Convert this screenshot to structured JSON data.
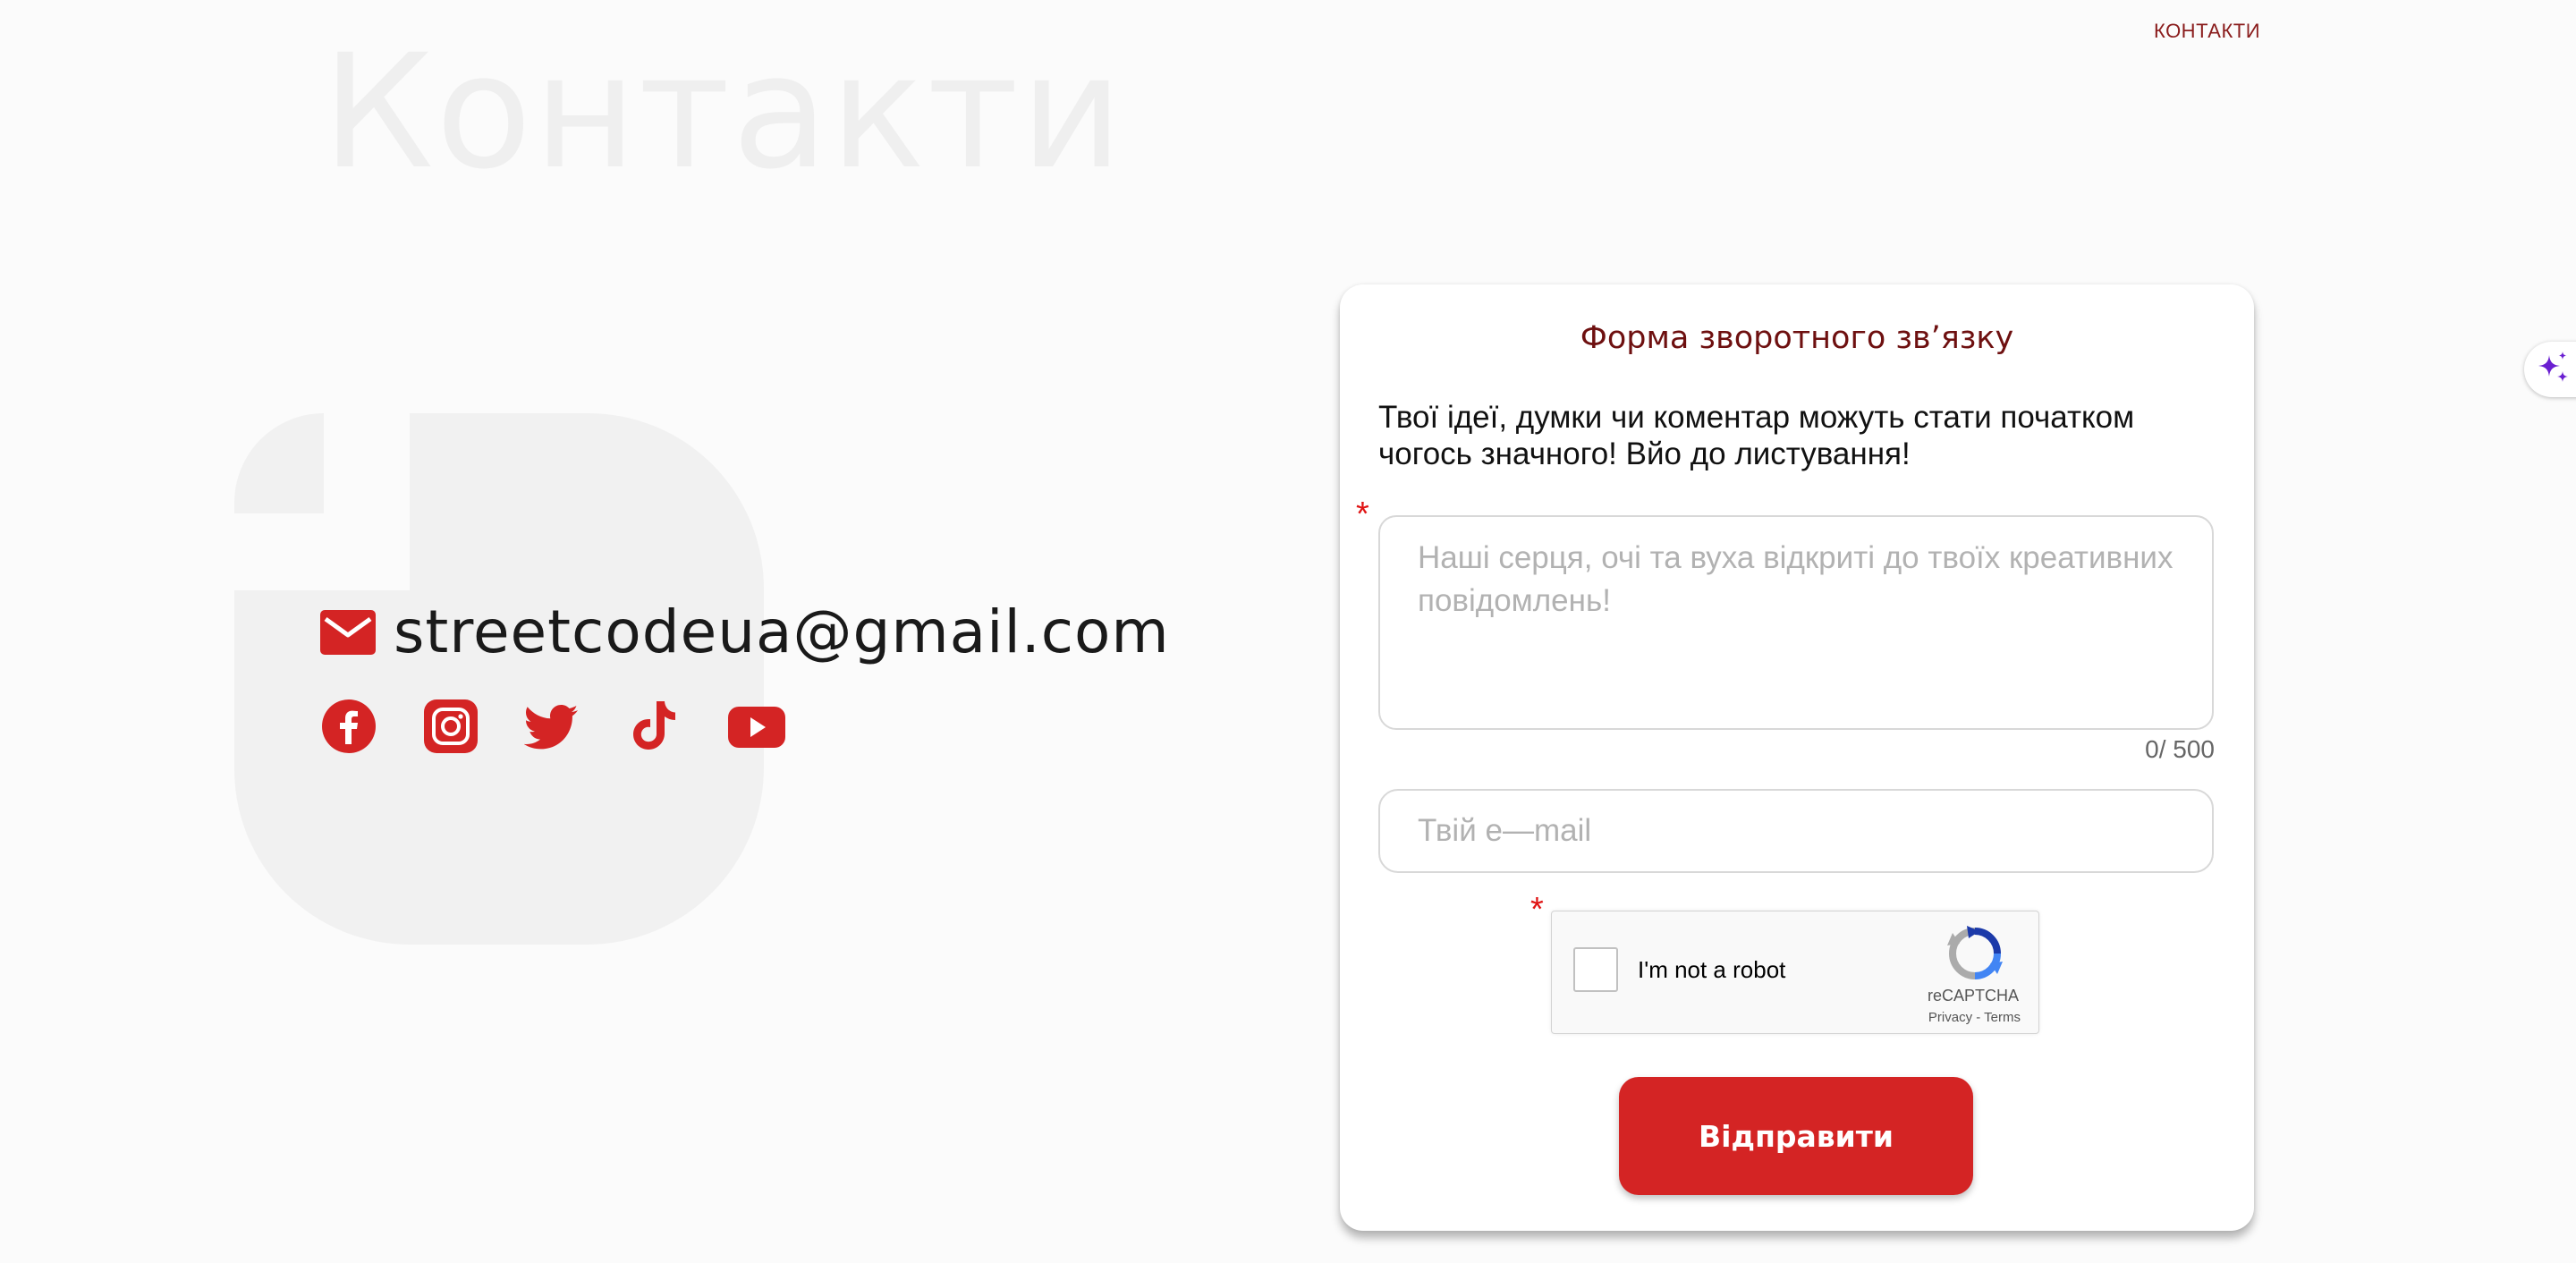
{
  "nav": {
    "breadcrumb": "КОНТАКТИ"
  },
  "page": {
    "title": "Контакти"
  },
  "contact": {
    "email": "streetcodeua@gmail.com",
    "socials": [
      "facebook-icon",
      "instagram-icon",
      "twitter-icon",
      "tiktok-icon",
      "youtube-icon"
    ]
  },
  "form": {
    "title": "Форма зворотного зв’язку",
    "intro": "Твої ідеї, думки чи коментар можуть стати початком чогось значного! Вйо до листування!",
    "required_mark": "*",
    "message": {
      "value": "",
      "placeholder": "Наші серця, очі та вуха відкриті до твоїх креативних повідомлень!"
    },
    "counter": "0/ 500",
    "email": {
      "value": "",
      "placeholder": "Твій e—mail"
    },
    "captcha": {
      "label": "I'm not a robot",
      "brand": "reCAPTCHA",
      "privacy": "Privacy",
      "sep": " - ",
      "terms": "Terms"
    },
    "submit_label": "Відправити"
  },
  "colors": {
    "accent": "#d42424",
    "title": "#6e1010",
    "background": "#fbfbfb",
    "watermark": "#f1f1f1",
    "sparkle": "#6a1fd1"
  }
}
